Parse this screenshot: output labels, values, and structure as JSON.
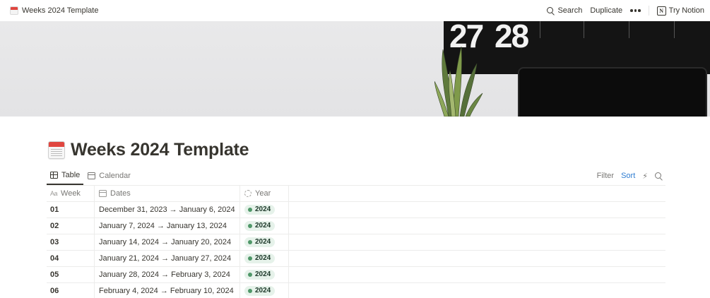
{
  "topbar": {
    "breadcrumb": "Weeks 2024 Template",
    "search_label": "Search",
    "duplicate_label": "Duplicate",
    "try_label": "Try Notion",
    "logo_letter": "N"
  },
  "cover": {
    "calendar_numbers": [
      "27",
      "28"
    ]
  },
  "page": {
    "title": "Weeks 2024 Template"
  },
  "views": {
    "tabs": [
      {
        "label": "Table",
        "icon": "table-icon",
        "active": true
      },
      {
        "label": "Calendar",
        "icon": "calendar-icon",
        "active": false
      }
    ],
    "filter_label": "Filter",
    "sort_label": "Sort"
  },
  "table": {
    "columns": [
      {
        "label": "Week",
        "icon": "text-property-icon"
      },
      {
        "label": "Dates",
        "icon": "date-property-icon"
      },
      {
        "label": "Year",
        "icon": "formula-property-icon"
      }
    ],
    "rows": [
      {
        "week": "01",
        "dates": "December 31, 2023 → January 6, 2024",
        "year": "2024"
      },
      {
        "week": "02",
        "dates": "January 7, 2024 → January 13, 2024",
        "year": "2024"
      },
      {
        "week": "03",
        "dates": "January 14, 2024 → January 20, 2024",
        "year": "2024"
      },
      {
        "week": "04",
        "dates": "January 21, 2024 → January 27, 2024",
        "year": "2024"
      },
      {
        "week": "05",
        "dates": "January 28, 2024 → February 3, 2024",
        "year": "2024"
      },
      {
        "week": "06",
        "dates": "February 4, 2024 → February 10, 2024",
        "year": "2024"
      }
    ]
  },
  "colors": {
    "sort_accent": "#2e7cd1",
    "tag_bg": "#e6f2ea",
    "tag_dot": "#4f9768"
  }
}
